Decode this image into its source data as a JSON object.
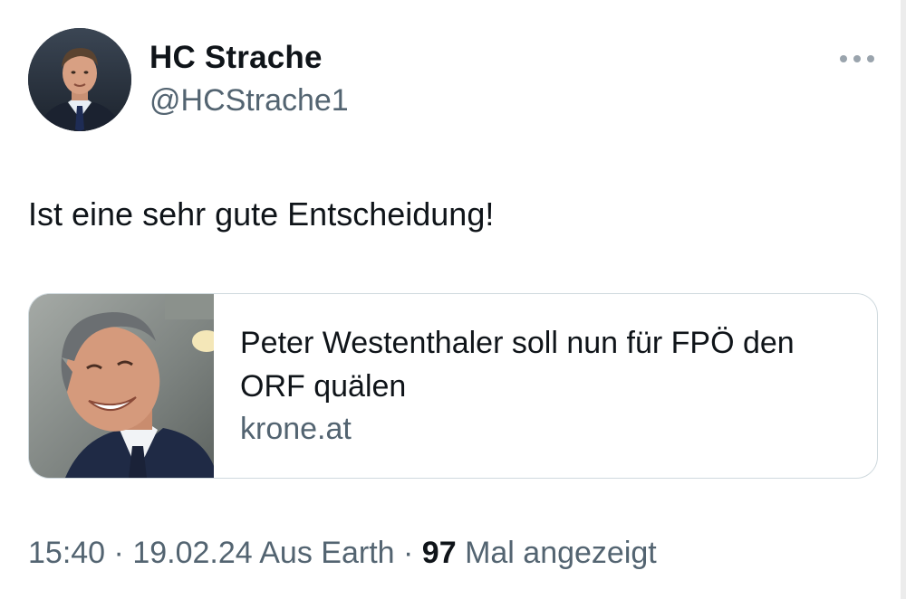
{
  "author": {
    "name": "HC Strache",
    "handle": "@HCStrache1",
    "avatar_icon": "profile-photo"
  },
  "more_icon": "more-dots-icon",
  "tweet": {
    "text": "Ist eine sehr gute Entscheidung!"
  },
  "link_card": {
    "title": "Peter Westenthaler soll nun für FPÖ den ORF quälen",
    "domain": "krone.at",
    "image_icon": "article-photo"
  },
  "meta": {
    "time": "15:40",
    "separator1": " · ",
    "date": "19.02.24",
    "source": "Aus Earth",
    "separator2": " · ",
    "views_count": "97",
    "views_label": "Mal angezeigt"
  },
  "colors": {
    "text_primary": "#0f1419",
    "text_secondary": "#536471",
    "card_border": "#cfd9de"
  }
}
